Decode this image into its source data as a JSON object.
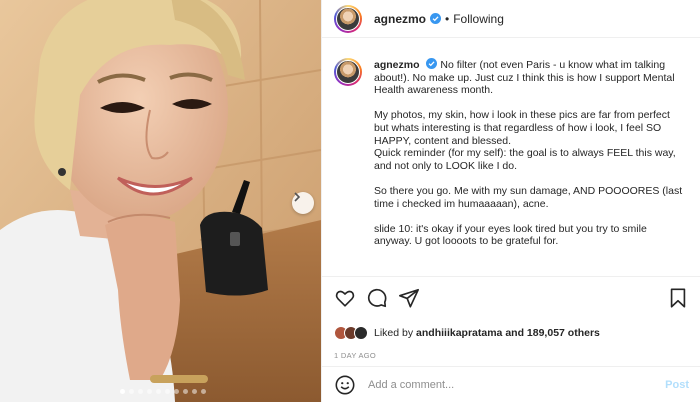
{
  "post": {
    "username": "agnezmo",
    "following_label": "Following",
    "separator": "•",
    "more_label": "•••"
  },
  "caption": {
    "username": "agnezmo",
    "paragraphs": [
      "No filter (not even Paris - u know what im talking about!). No make up. Just cuz I think this is how I support Mental Health awareness month.",
      "My photos, my skin, how i look in these pics are far from perfect but whats interesting is that regardless of how i look, I feel SO HAPPY, content and blessed.",
      "Quick reminder (for my self): the goal is to always FEEL this way, and not only to LOOK like I do.",
      "So there you go. Me with my sun damage, AND POOOORES (last time i checked im humaaaaan), acne.",
      "slide 10: it's okay if your eyes look tired but you try to smile anyway. U got loooots to be grateful for."
    ]
  },
  "likes": {
    "prefix": "Liked by",
    "user": "andhiiikapratama",
    "suffix": "and 189,057 others"
  },
  "timestamp": "1 DAY AGO",
  "comment": {
    "placeholder": "Add a comment...",
    "post_label": "Post"
  },
  "carousel": {
    "count": 10,
    "active_index": 0
  },
  "colors": {
    "verified": "#3897f0",
    "post_button": "#b2dffc",
    "muted": "#8e8e8e"
  },
  "icons": [
    "heart-icon",
    "comment-icon",
    "share-icon",
    "bookmark-icon",
    "emoji-icon",
    "verified-badge-icon",
    "carousel-next-icon"
  ]
}
